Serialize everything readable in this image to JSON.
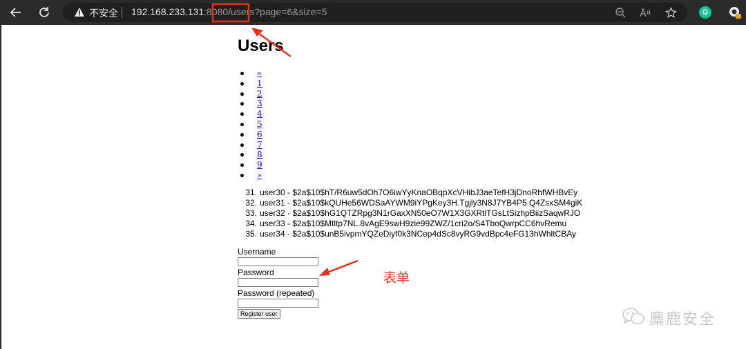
{
  "browser": {
    "security_label": "不安全",
    "url_host": "192.168.233.131",
    "url_rest": ":8080/users?page=6&size=5"
  },
  "page": {
    "title": "Users",
    "pagination": [
      {
        "label": "«"
      },
      {
        "label": "1"
      },
      {
        "label": "2"
      },
      {
        "label": "3"
      },
      {
        "label": "4"
      },
      {
        "label": "5"
      },
      {
        "label": "6"
      },
      {
        "label": "7"
      },
      {
        "label": "8"
      },
      {
        "label": "9"
      },
      {
        "label": "»"
      }
    ],
    "users": [
      {
        "num": "31.",
        "text": "user30 - $2a$10$hT/R6uw5dOh7O6iwYyKnaOBqpXcVHibJ3aeTefH3jDnoRhfWHBvEy"
      },
      {
        "num": "32.",
        "text": "user31 - $2a$10$kQUHe56WDSaAYWM9iYPgKey3H.Tgjly3N8J7YB4P5.Q4ZsxSM4giK"
      },
      {
        "num": "33.",
        "text": "user32 - $2a$10$hG1QTZRpg3N1rGaxXN50eO7W1X3GXRtlTGsLtSizhpBiizSaqwRJO"
      },
      {
        "num": "34.",
        "text": "user33 - $2a$10$Mtltp7NL.8vAgE9swH9zie99ZWZ/1cri2o/S4TboQwrpCC6hvRemu"
      },
      {
        "num": "35.",
        "text": "user34 - $2a$10$unB5ivpmYQZeDiyf0k3NCep4dSc8vyRG9vdBpc4eFG13hWhltCBAy"
      }
    ],
    "form": {
      "username_label": "Username",
      "password_label": "Password",
      "password_repeat_label": "Password (repeated)",
      "submit_label": "Register user"
    }
  },
  "annotation": {
    "label": "表单",
    "color": "#e8321e"
  },
  "watermark": {
    "text": "麋鹿安全"
  }
}
